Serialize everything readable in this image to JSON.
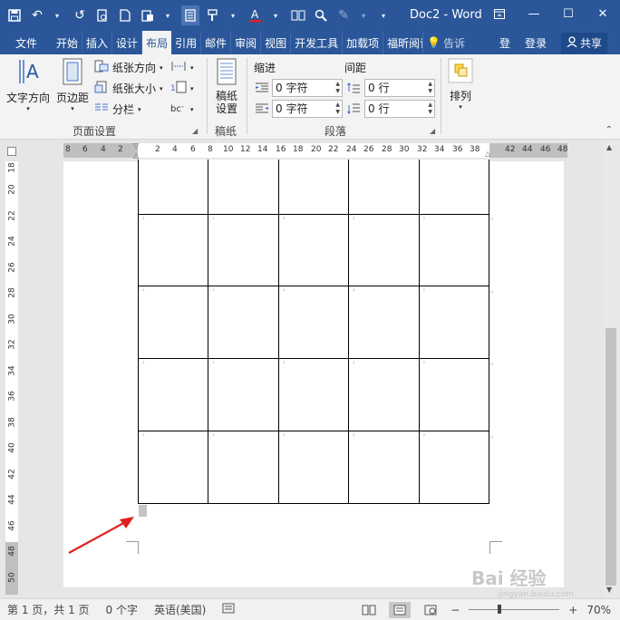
{
  "titlebar": {
    "doc_title": "Doc2 - Word",
    "window_buttons": [
      "restore-ribbon",
      "minimize",
      "maximize",
      "close"
    ]
  },
  "tabs": [
    "文件",
    "开始",
    "插入",
    "设计",
    "布局",
    "引用",
    "邮件",
    "审阅",
    "视图",
    "开发工具",
    "加载项",
    "福昕阅读"
  ],
  "active_tab": "布局",
  "tell_me": "告诉",
  "tabs_right": {
    "login1": "登",
    "login2": "登录",
    "share": "共享"
  },
  "ribbon": {
    "page_setup": {
      "text_direction": "文字方向",
      "margins": "页边距",
      "orientation": "纸张方向",
      "size": "纸张大小",
      "columns": "分栏",
      "group_label": "页面设置"
    },
    "draft": {
      "button": "稿纸\n设置",
      "group_label": "稿纸"
    },
    "paragraph": {
      "indent_label": "缩进",
      "spacing_label": "间距",
      "indent_left": "0 字符",
      "indent_right": "0 字符",
      "spacing_before": "0 行",
      "spacing_after": "0 行",
      "group_label": "段落"
    },
    "arrange": {
      "button": "排列"
    }
  },
  "ruler": {
    "h_left": [
      "8",
      "6",
      "4",
      "2"
    ],
    "h_right": [
      "2",
      "4",
      "6",
      "8",
      "10",
      "12",
      "14",
      "16",
      "18",
      "20",
      "22",
      "24",
      "26",
      "28",
      "30",
      "32",
      "34",
      "36",
      "38",
      "42",
      "44",
      "46",
      "48"
    ],
    "v": [
      "18",
      "20",
      "22",
      "24",
      "26",
      "28",
      "30",
      "32",
      "34",
      "36",
      "38",
      "40",
      "42",
      "44",
      "46",
      "48",
      "50"
    ]
  },
  "table": {
    "rows": 5,
    "cols": 5,
    "cell_mark": "²"
  },
  "status": {
    "page": "第 1 页，共 1 页",
    "words": "0 个字",
    "language": "英语(美国)",
    "zoom": "70%"
  },
  "watermark": {
    "main": "Bai 经验",
    "sub": "jingyan.baidu.com"
  }
}
